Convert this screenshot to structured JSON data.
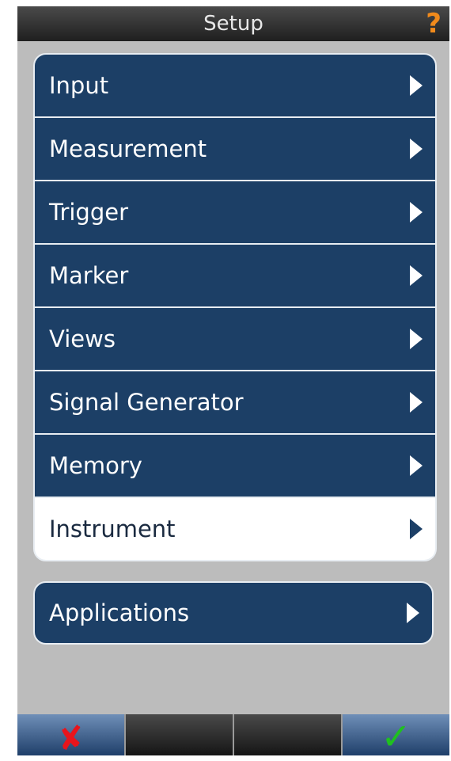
{
  "header": {
    "title": "Setup",
    "help_icon": "question-mark-icon",
    "help_glyph": "?",
    "help_color": "#f08a1c"
  },
  "menu": {
    "items": [
      {
        "label": "Input",
        "selected": false
      },
      {
        "label": "Measurement",
        "selected": false
      },
      {
        "label": "Trigger",
        "selected": false
      },
      {
        "label": "Marker",
        "selected": false
      },
      {
        "label": "Views",
        "selected": false
      },
      {
        "label": "Signal Generator",
        "selected": false
      },
      {
        "label": "Memory",
        "selected": false
      },
      {
        "label": "Instrument",
        "selected": true
      }
    ]
  },
  "applications": {
    "label": "Applications"
  },
  "toolbar": {
    "cancel_icon": "red-x-icon",
    "cancel_glyph": "✘",
    "ok_icon": "green-check-icon",
    "ok_glyph": "✓"
  },
  "colors": {
    "item_background": "#1c3f66",
    "selected_background": "#ffffff",
    "panel_background": "#bcbcbc",
    "cancel_color": "#e8141c",
    "ok_color": "#1fc01f"
  }
}
